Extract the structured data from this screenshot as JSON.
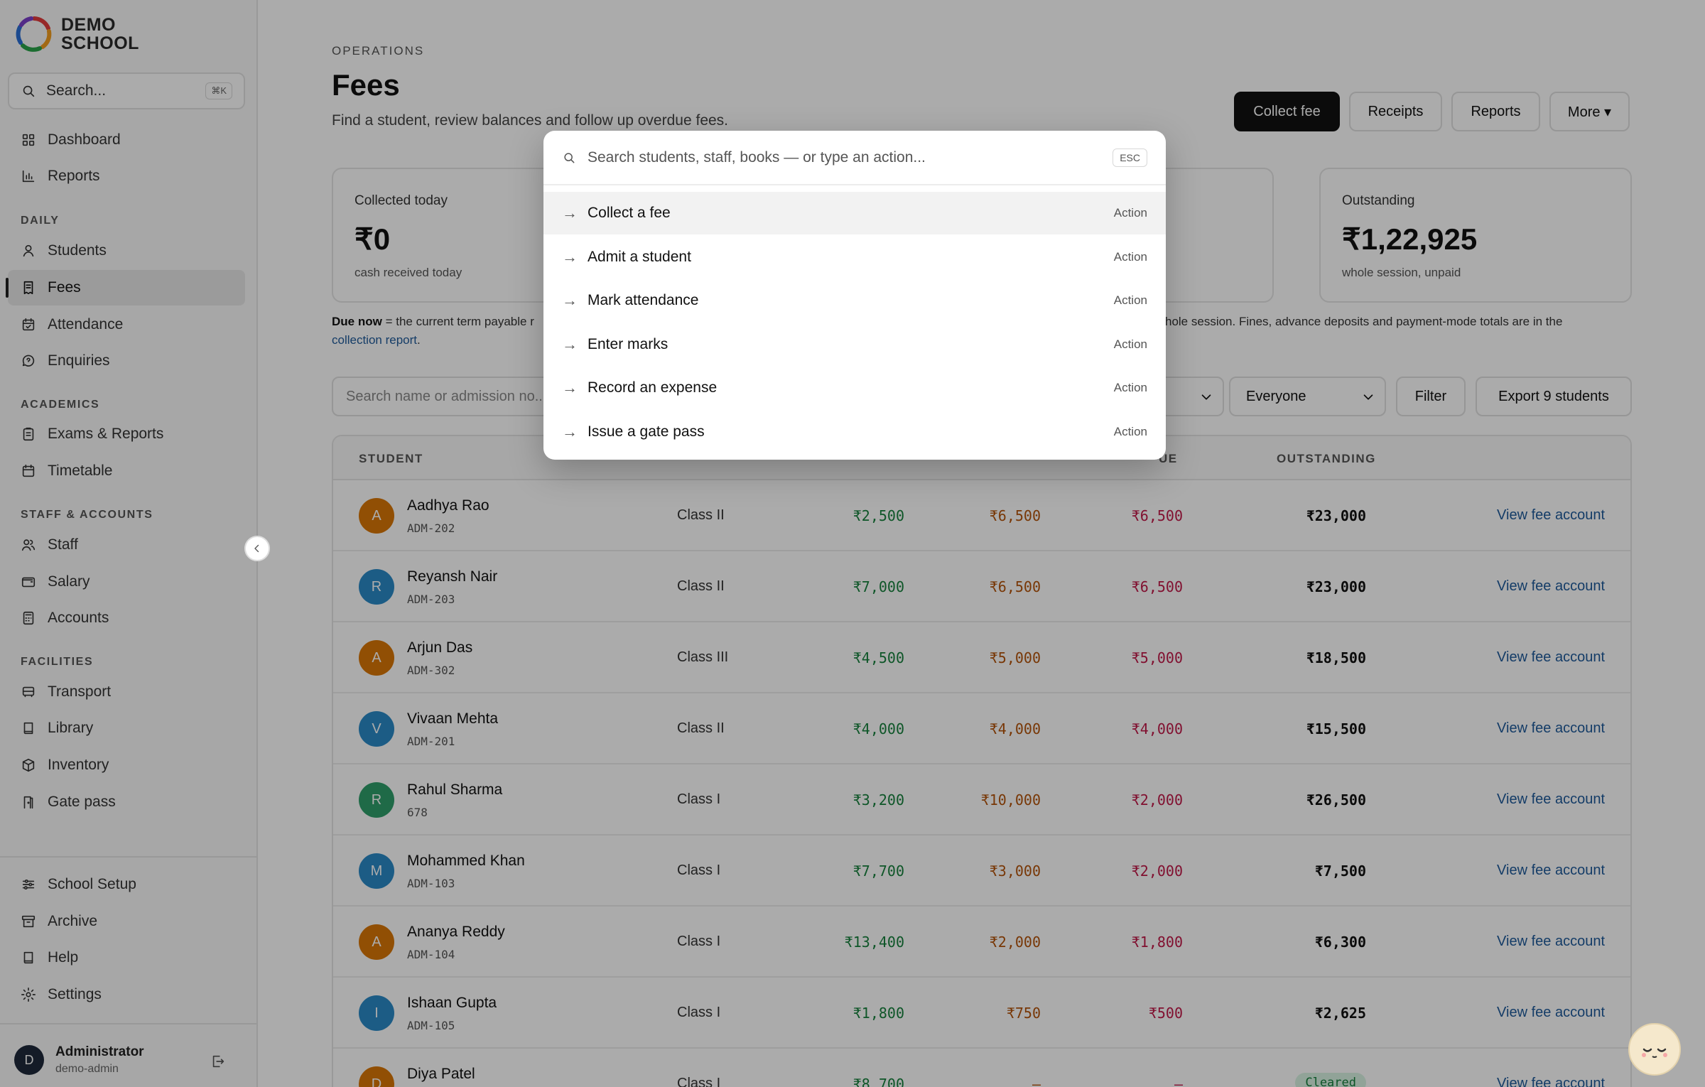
{
  "brand": {
    "line1": "DEMO",
    "line2": "SCHOOL",
    "logo_colors": [
      "#e23b3b",
      "#f29d1f",
      "#2aa34a",
      "#2b6fd6",
      "#7b3fc9"
    ]
  },
  "sidebar": {
    "search_placeholder": "Search...",
    "search_shortcut": "⌘K",
    "items_top": [
      {
        "label": "Dashboard",
        "icon": "grid-icon"
      },
      {
        "label": "Reports",
        "icon": "bar-chart-icon"
      }
    ],
    "sections": [
      {
        "title": "DAILY",
        "items": [
          {
            "label": "Students",
            "icon": "user-icon"
          },
          {
            "label": "Fees",
            "icon": "receipt-icon",
            "active": true
          },
          {
            "label": "Attendance",
            "icon": "calendar-check-icon"
          },
          {
            "label": "Enquiries",
            "icon": "chat-icon"
          }
        ]
      },
      {
        "title": "ACADEMICS",
        "items": [
          {
            "label": "Exams & Reports",
            "icon": "clipboard-icon"
          },
          {
            "label": "Timetable",
            "icon": "calendar-icon"
          }
        ]
      },
      {
        "title": "STAFF & ACCOUNTS",
        "items": [
          {
            "label": "Staff",
            "icon": "users-icon"
          },
          {
            "label": "Salary",
            "icon": "wallet-icon"
          },
          {
            "label": "Accounts",
            "icon": "calculator-icon"
          }
        ]
      },
      {
        "title": "FACILITIES",
        "items": [
          {
            "label": "Transport",
            "icon": "bus-icon"
          },
          {
            "label": "Library",
            "icon": "book-icon"
          },
          {
            "label": "Inventory",
            "icon": "box-icon"
          },
          {
            "label": "Gate pass",
            "icon": "door-icon"
          }
        ]
      }
    ],
    "items_bottom": [
      {
        "label": "School Setup",
        "icon": "sliders-icon"
      },
      {
        "label": "Archive",
        "icon": "archive-icon"
      },
      {
        "label": "Help",
        "icon": "help-book-icon"
      },
      {
        "label": "Settings",
        "icon": "gear-icon"
      }
    ],
    "user": {
      "initial": "D",
      "name": "Administrator",
      "role": "demo-admin"
    }
  },
  "header": {
    "kicker": "OPERATIONS",
    "title": "Fees",
    "subtitle": "Find a student, review balances and follow up overdue fees.",
    "buttons": {
      "collect": "Collect fee",
      "receipts": "Receipts",
      "reports": "Reports",
      "more": "More ▾"
    }
  },
  "cards": [
    {
      "label": "Collected today",
      "value": "₹0",
      "sub": "cash received today"
    },
    {
      "label": "Outstanding",
      "value": "₹1,22,925",
      "sub": "whole session, unpaid"
    }
  ],
  "note": {
    "bold": "Due now",
    "left": " = the current term payable r",
    "right": "hole session. Fines, advance deposits and payment-mode totals are in the",
    "link": "collection report",
    "end": "."
  },
  "filters": {
    "search_placeholder": "Search name or admission no...",
    "terms_partial": "rms",
    "who": "Everyone",
    "filter_btn": "Filter",
    "export_btn": "Export 9 students"
  },
  "table": {
    "headers": {
      "student": "STUDENT",
      "due_partial": "UE",
      "outstanding": "OUTSTANDING"
    },
    "rows": [
      {
        "initial": "A",
        "color": "#d97706",
        "name": "Aadhya Rao",
        "id": "ADM-202",
        "cls": "Class II",
        "paid": "₹2,500",
        "term": "₹6,500",
        "due": "₹6,500",
        "outstanding": "₹23,000",
        "link": "View fee account"
      },
      {
        "initial": "R",
        "color": "#2b8ac6",
        "name": "Reyansh Nair",
        "id": "ADM-203",
        "cls": "Class II",
        "paid": "₹7,000",
        "term": "₹6,500",
        "due": "₹6,500",
        "outstanding": "₹23,000",
        "link": "View fee account"
      },
      {
        "initial": "A",
        "color": "#d97706",
        "name": "Arjun Das",
        "id": "ADM-302",
        "cls": "Class III",
        "paid": "₹4,500",
        "term": "₹5,000",
        "due": "₹5,000",
        "outstanding": "₹18,500",
        "link": "View fee account"
      },
      {
        "initial": "V",
        "color": "#2b8ac6",
        "name": "Vivaan Mehta",
        "id": "ADM-201",
        "cls": "Class II",
        "paid": "₹4,000",
        "term": "₹4,000",
        "due": "₹4,000",
        "outstanding": "₹15,500",
        "link": "View fee account"
      },
      {
        "initial": "R",
        "color": "#2f9e6a",
        "name": "Rahul Sharma",
        "id": "678",
        "cls": "Class I",
        "paid": "₹3,200",
        "term": "₹10,000",
        "due": "₹2,000",
        "outstanding": "₹26,500",
        "link": "View fee account"
      },
      {
        "initial": "M",
        "color": "#2b8ac6",
        "name": "Mohammed Khan",
        "id": "ADM-103",
        "cls": "Class I",
        "paid": "₹7,700",
        "term": "₹3,000",
        "due": "₹2,000",
        "outstanding": "₹7,500",
        "link": "View fee account"
      },
      {
        "initial": "A",
        "color": "#d97706",
        "name": "Ananya Reddy",
        "id": "ADM-104",
        "cls": "Class I",
        "paid": "₹13,400",
        "term": "₹2,000",
        "due": "₹1,800",
        "outstanding": "₹6,300",
        "link": "View fee account"
      },
      {
        "initial": "I",
        "color": "#2b8ac6",
        "name": "Ishaan Gupta",
        "id": "ADM-105",
        "cls": "Class I",
        "paid": "₹1,800",
        "term": "₹750",
        "due": "₹500",
        "outstanding": "₹2,625",
        "link": "View fee account"
      },
      {
        "initial": "D",
        "color": "#d97706",
        "name": "Diya Patel",
        "id": "",
        "cls": "Class I",
        "paid": "₹8,700",
        "term": "—",
        "due": "—",
        "outstanding": "",
        "badge": "Cleared",
        "link": "View fee account"
      }
    ]
  },
  "palette": {
    "search_placeholder": "Search students, staff, books — or type an action...",
    "esc": "ESC",
    "items": [
      {
        "label": "Collect a fee",
        "tag": "Action"
      },
      {
        "label": "Admit a student",
        "tag": "Action"
      },
      {
        "label": "Mark attendance",
        "tag": "Action"
      },
      {
        "label": "Enter marks",
        "tag": "Action"
      },
      {
        "label": "Record an expense",
        "tag": "Action"
      },
      {
        "label": "Issue a gate pass",
        "tag": "Action"
      }
    ]
  }
}
